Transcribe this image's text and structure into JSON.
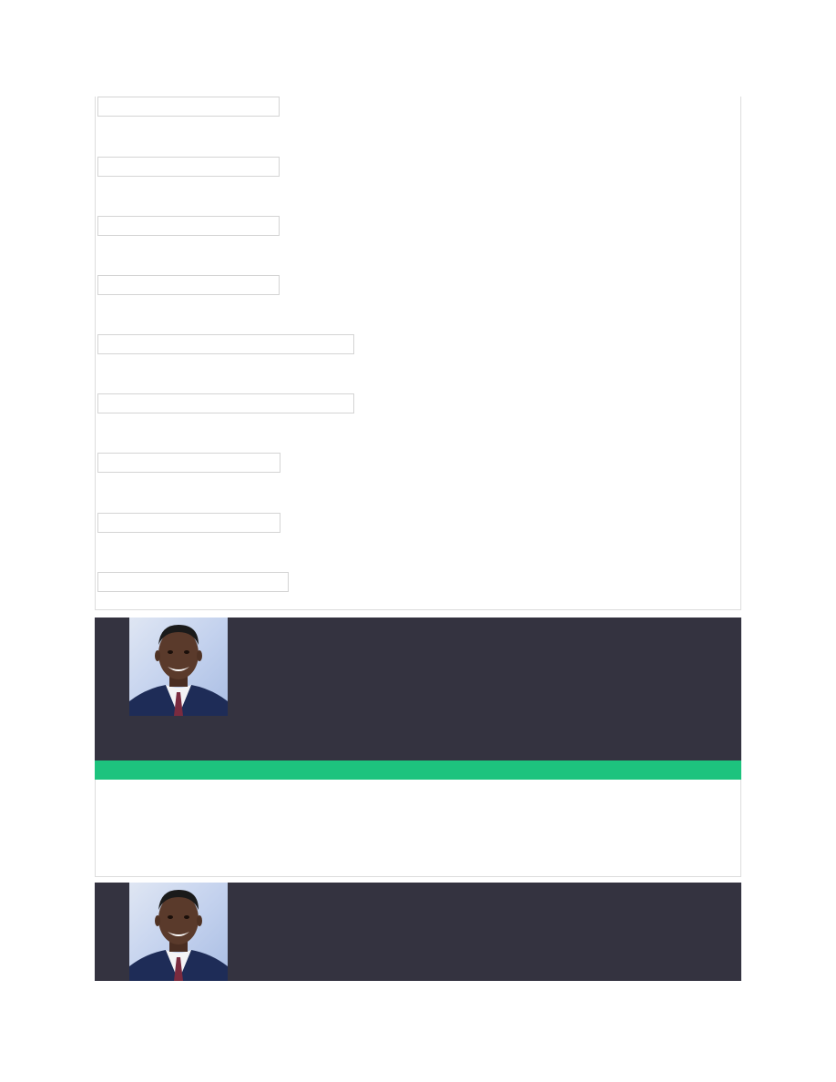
{
  "form": {
    "fields": [
      {
        "value": "",
        "placeholder": ""
      },
      {
        "value": "",
        "placeholder": ""
      },
      {
        "value": "",
        "placeholder": ""
      },
      {
        "value": "",
        "placeholder": ""
      },
      {
        "value": "",
        "placeholder": ""
      },
      {
        "value": "",
        "placeholder": ""
      },
      {
        "value": "",
        "placeholder": ""
      },
      {
        "value": "",
        "placeholder": ""
      },
      {
        "value": "",
        "placeholder": ""
      }
    ]
  },
  "profiles": [
    {
      "avatar_icon": "person-photo"
    },
    {
      "avatar_icon": "person-photo"
    }
  ],
  "colors": {
    "banner": "#343340",
    "accent": "#1dc37e",
    "field_border": "#d4d4d4",
    "panel_border": "#dcdcdc"
  }
}
